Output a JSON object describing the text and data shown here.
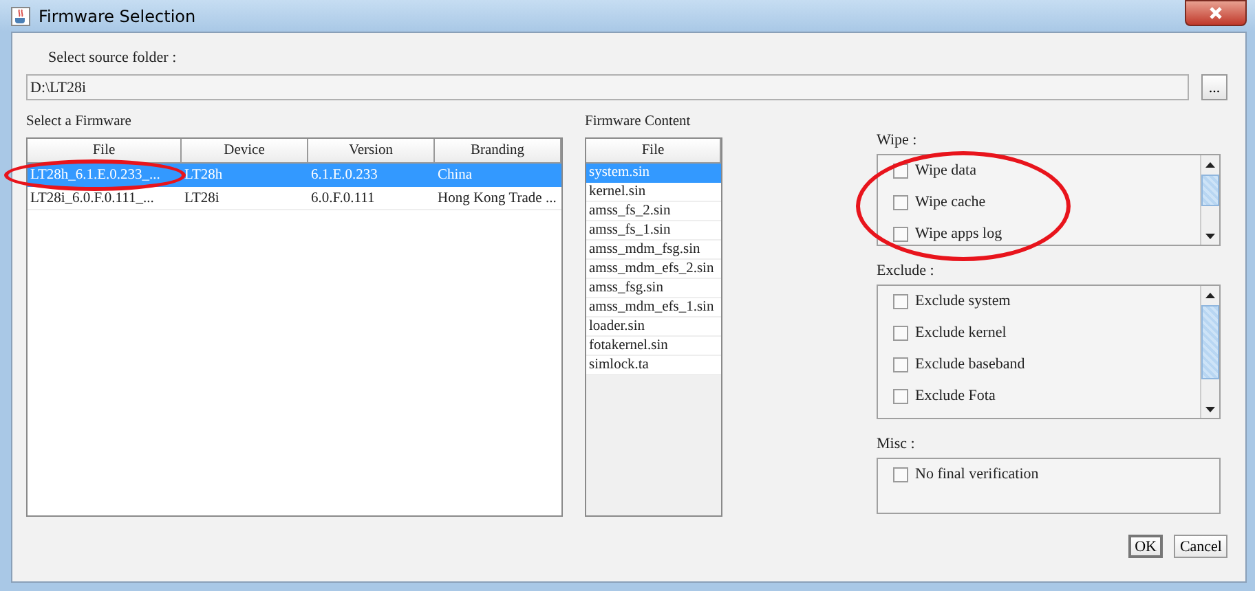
{
  "window": {
    "title": "Firmware Selection"
  },
  "source_folder": {
    "label": "Select source folder :",
    "value": "D:\\LT28i",
    "browse_button": "..."
  },
  "firmware_table": {
    "label": "Select a Firmware",
    "columns": [
      "File",
      "Device",
      "Version",
      "Branding"
    ],
    "rows": [
      {
        "cells": [
          "LT28h_6.1.E.0.233_...",
          "LT28h",
          "6.1.E.0.233",
          "China"
        ],
        "selected": true
      },
      {
        "cells": [
          "LT28i_6.0.F.0.111_...",
          "LT28i",
          "6.0.F.0.111",
          "Hong Kong Trade ..."
        ],
        "selected": false
      }
    ]
  },
  "content_table": {
    "label": "Firmware Content",
    "columns": [
      "File"
    ],
    "rows": [
      {
        "cells": [
          "system.sin"
        ],
        "selected": true
      },
      {
        "cells": [
          "kernel.sin"
        ],
        "selected": false
      },
      {
        "cells": [
          "amss_fs_2.sin"
        ],
        "selected": false
      },
      {
        "cells": [
          "amss_fs_1.sin"
        ],
        "selected": false
      },
      {
        "cells": [
          "amss_mdm_fsg.sin"
        ],
        "selected": false
      },
      {
        "cells": [
          "amss_mdm_efs_2.sin"
        ],
        "selected": false
      },
      {
        "cells": [
          "amss_fsg.sin"
        ],
        "selected": false
      },
      {
        "cells": [
          "amss_mdm_efs_1.sin"
        ],
        "selected": false
      },
      {
        "cells": [
          "loader.sin"
        ],
        "selected": false
      },
      {
        "cells": [
          "fotakernel.sin"
        ],
        "selected": false
      },
      {
        "cells": [
          "simlock.ta"
        ],
        "selected": false
      }
    ]
  },
  "wipe": {
    "label": "Wipe :",
    "scrollable": true,
    "items": [
      {
        "label": "Wipe data",
        "checked": false
      },
      {
        "label": "Wipe cache",
        "checked": false
      },
      {
        "label": "Wipe apps log",
        "checked": false
      }
    ]
  },
  "exclude": {
    "label": "Exclude :",
    "scrollable": true,
    "items": [
      {
        "label": "Exclude system",
        "checked": false
      },
      {
        "label": "Exclude kernel",
        "checked": false
      },
      {
        "label": "Exclude baseband",
        "checked": false
      },
      {
        "label": "Exclude Fota",
        "checked": false
      }
    ]
  },
  "misc": {
    "label": "Misc :",
    "scrollable": false,
    "items": [
      {
        "label": "No final verification",
        "checked": false
      }
    ]
  },
  "buttons": [
    "OK",
    "Cancel"
  ],
  "annotations": [
    {
      "kind": "ellipse"
    },
    {
      "kind": "ellipse"
    }
  ]
}
